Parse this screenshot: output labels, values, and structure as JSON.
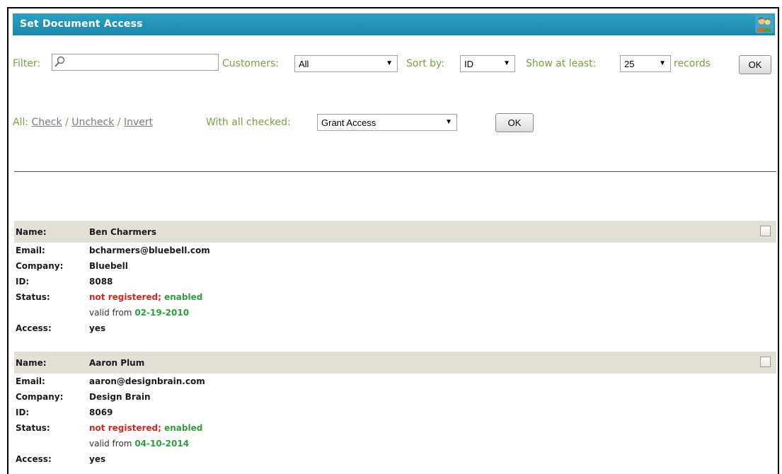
{
  "titlebar": {
    "title": "Set Document Access",
    "icon": "people-icon"
  },
  "filters": {
    "filter_label": "Filter:",
    "filter_value": "",
    "customers_label": "Customers:",
    "customers_value": "All",
    "sortby_label": "Sort by:",
    "sortby_value": "ID",
    "show_label": "Show at least:",
    "show_value": "25",
    "records_label": "records",
    "ok_label": "OK"
  },
  "bulk": {
    "all_label": "All:",
    "check_label": "Check",
    "uncheck_label": "Uncheck",
    "invert_label": "Invert",
    "slash": "/",
    "with_checked_label": "With all checked:",
    "action_value": "Grant Access",
    "ok_label": "OK"
  },
  "field_labels": {
    "name": "Name:",
    "email": "Email:",
    "company": "Company:",
    "id": "ID:",
    "status": "Status:",
    "access": "Access:"
  },
  "records": [
    {
      "name": "Ben Charmers",
      "email": "bcharmers@bluebell.com",
      "company": "Bluebell",
      "id": "8088",
      "status_reg": "not registered;",
      "status_enabled": "enabled",
      "valid_prefix": "valid from",
      "valid_date": "02-19-2010",
      "access": "yes",
      "checked": false
    },
    {
      "name": "Aaron Plum",
      "email": "aaron@designbrain.com",
      "company": "Design Brain",
      "id": "8069",
      "status_reg": "not registered;",
      "status_enabled": "enabled",
      "valid_prefix": "valid from",
      "valid_date": "04-10-2014",
      "access": "yes",
      "checked": false
    }
  ],
  "colors": {
    "titlebar": "#1c87aa",
    "label_green": "#7aa23a",
    "status_red": "#e0231b",
    "status_green": "#2aa23a",
    "header_row": "#e3e0d6"
  }
}
